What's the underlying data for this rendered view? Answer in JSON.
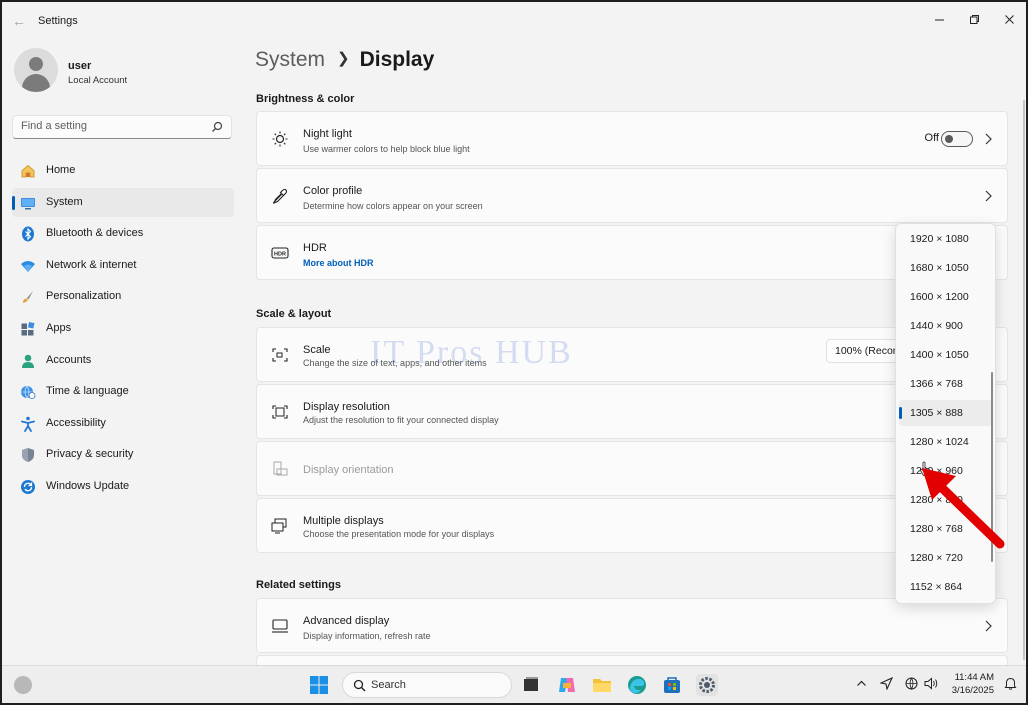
{
  "window": {
    "title": "Settings"
  },
  "user": {
    "name": "user",
    "account": "Local Account"
  },
  "search": {
    "placeholder": "Find a setting"
  },
  "nav": [
    {
      "label": "Home",
      "icon": "home-icon"
    },
    {
      "label": "System",
      "icon": "system-icon",
      "active": true
    },
    {
      "label": "Bluetooth & devices",
      "icon": "bluetooth-icon"
    },
    {
      "label": "Network & internet",
      "icon": "wifi-icon"
    },
    {
      "label": "Personalization",
      "icon": "brush-icon"
    },
    {
      "label": "Apps",
      "icon": "apps-icon"
    },
    {
      "label": "Accounts",
      "icon": "accounts-icon"
    },
    {
      "label": "Time & language",
      "icon": "globe-clock-icon"
    },
    {
      "label": "Accessibility",
      "icon": "accessibility-icon"
    },
    {
      "label": "Privacy & security",
      "icon": "shield-icon"
    },
    {
      "label": "Windows Update",
      "icon": "update-icon"
    }
  ],
  "breadcrumb": {
    "parent": "System",
    "current": "Display"
  },
  "sections": {
    "brightness": "Brightness & color",
    "scale_layout": "Scale & layout",
    "related": "Related settings"
  },
  "cards": {
    "night_light": {
      "title": "Night light",
      "subtitle": "Use warmer colors to help block blue light",
      "toggle_label": "Off"
    },
    "color_profile": {
      "title": "Color profile",
      "subtitle": "Determine how colors appear on your screen"
    },
    "hdr": {
      "title": "HDR",
      "link": "More about HDR"
    },
    "scale": {
      "title": "Scale",
      "subtitle": "Change the size of text, apps, and other items",
      "value": "100% (Recommended)"
    },
    "resolution": {
      "title": "Display resolution",
      "subtitle": "Adjust the resolution to fit your connected display"
    },
    "orientation": {
      "title": "Display orientation"
    },
    "multiple": {
      "title": "Multiple displays",
      "subtitle": "Choose the presentation mode for your displays"
    },
    "advanced": {
      "title": "Advanced display",
      "subtitle": "Display information, refresh rate"
    }
  },
  "resolution_options": [
    "1920 × 1080",
    "1680 × 1050",
    "1600 × 1200",
    "1440 × 900",
    "1400 × 1050",
    "1366 × 768",
    "1305 × 888",
    "1280 × 1024",
    "1280 × 960",
    "1280 × 800",
    "1280 × 768",
    "1280 × 720",
    "1152 × 864"
  ],
  "resolution_selected": "1305 × 888",
  "watermark": "IT Pros HUB",
  "taskbar": {
    "search_label": "Search",
    "time": "11:44 AM",
    "date": "3/16/2025"
  },
  "colors": {
    "accent": "#005fb8",
    "annotation_arrow": "#e30000"
  }
}
